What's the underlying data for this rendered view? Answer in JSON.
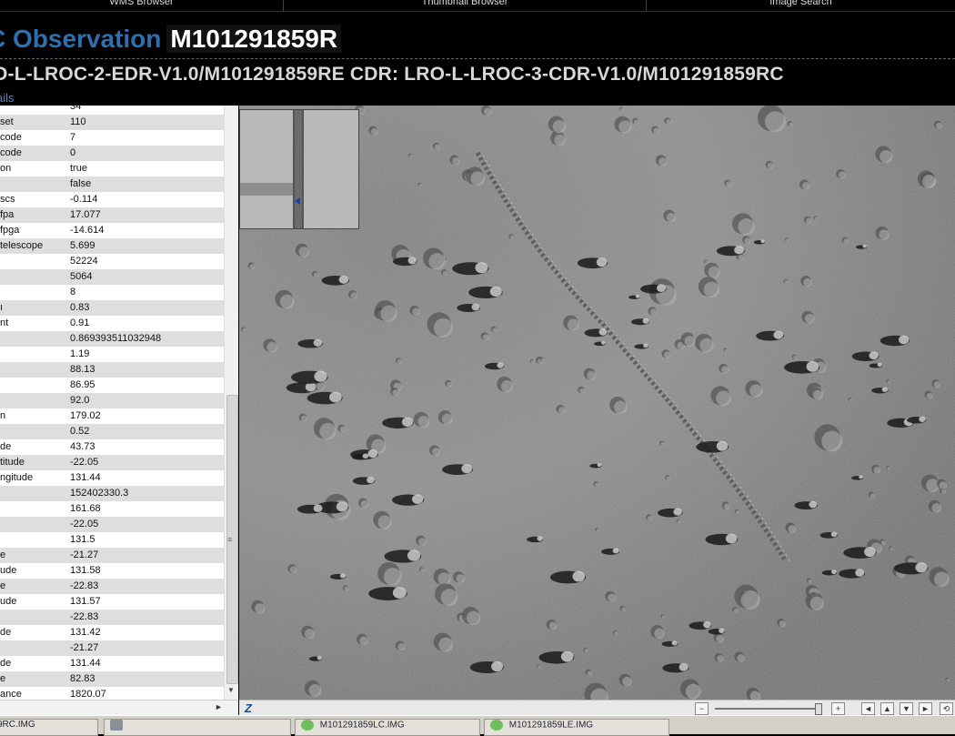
{
  "nav": {
    "tabs": [
      "WMS Browser",
      "Thumbnail Browser",
      "Image Search"
    ]
  },
  "header": {
    "title_prefix": "C Observation",
    "product_id": "M101291859R",
    "pids": "O-L-LROC-2-EDR-V1.0/M101291859RE CDR: LRO-L-LROC-3-CDR-V1.0/M101291859RC",
    "details_link": "ails"
  },
  "table": {
    "rows": [
      {
        "k": "",
        "v": "34"
      },
      {
        "k": "set",
        "v": "110"
      },
      {
        "k": "code",
        "v": "7"
      },
      {
        "k": "code",
        "v": "0"
      },
      {
        "k": "on",
        "v": "true"
      },
      {
        "k": "",
        "v": "false"
      },
      {
        "k": "scs",
        "v": "-0.114"
      },
      {
        "k": "fpa",
        "v": "17.077"
      },
      {
        "k": "fpga",
        "v": "-14.614"
      },
      {
        "k": "telescope",
        "v": "5.699"
      },
      {
        "k": "",
        "v": "52224"
      },
      {
        "k": "",
        "v": "5064"
      },
      {
        "k": "",
        "v": "8"
      },
      {
        "k": "ı",
        "v": "0.83"
      },
      {
        "k": "nt",
        "v": "0.91"
      },
      {
        "k": "",
        "v": "0.869393511032948"
      },
      {
        "k": "",
        "v": "1.19"
      },
      {
        "k": "",
        "v": "88.13"
      },
      {
        "k": "",
        "v": "86.95"
      },
      {
        "k": "",
        "v": "92.0"
      },
      {
        "k": "n",
        "v": "179.02"
      },
      {
        "k": "",
        "v": "0.52"
      },
      {
        "k": "de",
        "v": "43.73"
      },
      {
        "k": "titude",
        "v": "-22.05"
      },
      {
        "k": "ngitude",
        "v": "131.44"
      },
      {
        "k": "",
        "v": "152402330.3"
      },
      {
        "k": "",
        "v": "161.68"
      },
      {
        "k": "",
        "v": "-22.05"
      },
      {
        "k": "",
        "v": "131.5"
      },
      {
        "k": "e",
        "v": "-21.27"
      },
      {
        "k": "ude",
        "v": "131.58"
      },
      {
        "k": "e",
        "v": "-22.83"
      },
      {
        "k": "ude",
        "v": "131.57"
      },
      {
        "k": "",
        "v": "-22.83"
      },
      {
        "k": "de",
        "v": "131.42"
      },
      {
        "k": "",
        "v": "-21.27"
      },
      {
        "k": "de",
        "v": "131.44"
      },
      {
        "k": "e",
        "v": "82.83"
      },
      {
        "k": "ance",
        "v": "1820.07"
      }
    ]
  },
  "zoom": {
    "logo": "Z",
    "minus": "−",
    "plus": "+"
  },
  "taskbar": {
    "items": [
      "9RC.IMG",
      "",
      "M101291859LC.IMG",
      "M101291859LE.IMG"
    ]
  },
  "colors": {
    "accent_blue": "#2e6fae",
    "link_blue": "#5b89c6",
    "row_alt": "#dedede"
  }
}
